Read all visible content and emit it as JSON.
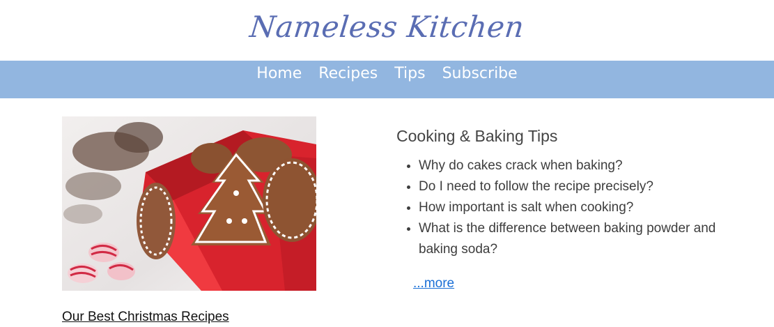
{
  "site": {
    "logo_text": "Nameless Kitchen"
  },
  "nav": {
    "items": [
      {
        "label": "Home"
      },
      {
        "label": "Recipes"
      },
      {
        "label": "Tips"
      },
      {
        "label": "Subscribe"
      }
    ]
  },
  "feature": {
    "link_text": "Our Best Christmas Recipes"
  },
  "tips": {
    "title": "Cooking & Baking Tips",
    "items": [
      "Why do cakes crack when baking?",
      "Do I need to follow the recipe precisely?",
      "How important is salt when cooking?",
      "What is the difference between baking powder and baking soda?"
    ],
    "more_text": "...more"
  },
  "colors": {
    "nav_bg": "#92b6e0",
    "logo": "#5a6db3",
    "link": "#1a6fd6"
  }
}
